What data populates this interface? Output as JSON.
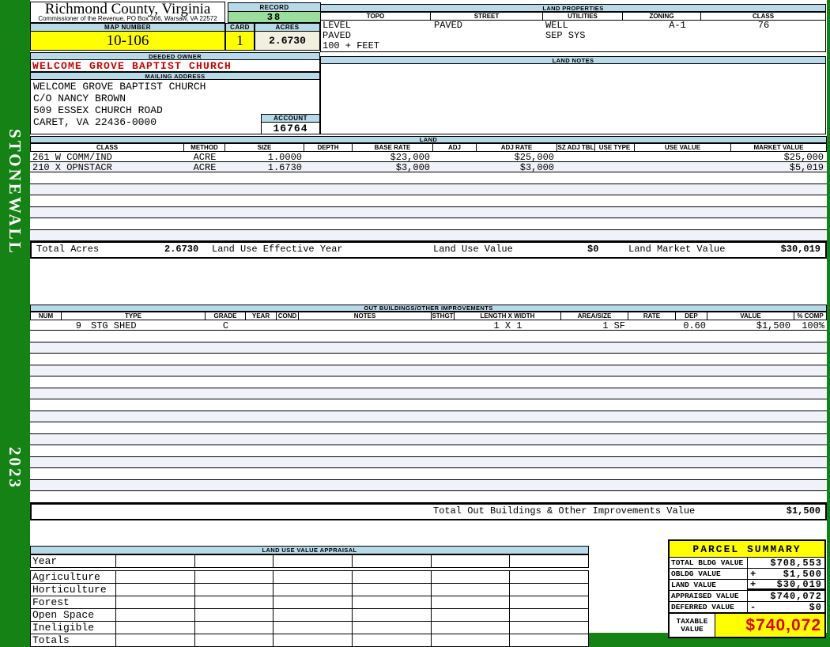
{
  "sidebar": {
    "district": "STONEWALL",
    "year": "2023"
  },
  "header": {
    "county": "Richmond County, Virginia",
    "office": "Commissioner of the Revenue, PO Box 366, Warsaw, VA 22572",
    "record_label": "RECORD",
    "record": "38",
    "map_number_label": "MAP NUMBER",
    "map_number": "10-106",
    "card_label": "CARD",
    "card": "1",
    "acres_label": "ACRES",
    "acres": "2.6730"
  },
  "land_properties": {
    "title": "LAND PROPERTIES",
    "columns": [
      "TOPO",
      "STREET",
      "UTILITIES",
      "ZONING",
      "CLASS"
    ],
    "topo": [
      "LEVEL",
      "PAVED",
      "100 + FEET"
    ],
    "street": "PAVED",
    "utilities": [
      "WELL",
      "SEP SYS"
    ],
    "zoning": "A-1",
    "class": "76"
  },
  "owner": {
    "deeded_owner_label": "DEEDED OWNER",
    "deeded_owner": "WELCOME GROVE BAPTIST CHURCH",
    "mailing_address_label": "MAILING ADDRESS",
    "mailing_address": [
      "WELCOME GROVE BAPTIST CHURCH",
      "C/O NANCY BROWN",
      "509 ESSEX CHURCH ROAD",
      "CARET, VA 22436-0000"
    ],
    "account_label": "ACCOUNT",
    "account": "16764"
  },
  "land_notes": {
    "title": "LAND NOTES"
  },
  "land": {
    "title": "LAND",
    "columns": [
      "CLASS",
      "METHOD",
      "SIZE",
      "DEPTH",
      "BASE RATE",
      "ADJ",
      "ADJ RATE",
      "SZ ADJ TBL",
      "USE TYPE",
      "USE VALUE",
      "MARKET VALUE"
    ],
    "rows": [
      {
        "class": "261 W COMM/IND",
        "method": "ACRE",
        "size": "1.0000",
        "depth": "",
        "base_rate": "$23,000",
        "adj": "",
        "adj_rate": "$25,000",
        "sz_adj_tbl": "",
        "use_type": "",
        "use_value": "",
        "market_value": "$25,000"
      },
      {
        "class": "210 X OPNSTACR",
        "method": "ACRE",
        "size": "1.6730",
        "depth": "",
        "base_rate": "$3,000",
        "adj": "",
        "adj_rate": "$3,000",
        "sz_adj_tbl": "",
        "use_type": "",
        "use_value": "",
        "market_value": "$5,019"
      }
    ],
    "totals": {
      "total_acres_label": "Total Acres",
      "total_acres": "2.6730",
      "effective_year_label": "Land Use Effective Year",
      "use_value_label": "Land Use Value",
      "use_value": "$0",
      "market_value_label": "Land Market Value",
      "market_value": "$30,019"
    }
  },
  "out_buildings": {
    "title": "OUT BUILDINGS/OTHER IMPROVEMENTS",
    "columns": [
      "NUM",
      "TYPE",
      "GRADE",
      "YEAR",
      "COND",
      "NOTES",
      "STHGT",
      "LENGTH X WIDTH",
      "AREA/SIZE",
      "RATE",
      "DEP",
      "VALUE",
      "% COMP"
    ],
    "rows": [
      {
        "num": "9",
        "type": "STG SHED",
        "grade": "C",
        "year": "",
        "cond": "",
        "notes": "",
        "sthgt": "",
        "length_width": "1 X 1",
        "area_size": "1 SF",
        "rate": "",
        "dep": "0.60",
        "value": "$1,500",
        "pct_comp": "100%"
      }
    ],
    "total_label": "Total Out Buildings & Other Improvements Value",
    "total_value": "$1,500"
  },
  "land_use_appraisal": {
    "title": "LAND USE VALUE APPRAISAL",
    "row_labels": [
      "Year",
      "Agriculture",
      "Horticulture",
      "Forest",
      "Open Space",
      "Ineligible",
      "Totals"
    ]
  },
  "parcel_summary": {
    "title": "PARCEL SUMMARY",
    "rows": [
      {
        "label": "TOTAL BLDG VALUE",
        "sign": "",
        "value": "$708,553"
      },
      {
        "label": "OBLDG VALUE",
        "sign": "+",
        "value": "$1,500"
      },
      {
        "label": "LAND VALUE",
        "sign": "+",
        "value": "$30,019"
      },
      {
        "label": "APPRAISED VALUE",
        "sign": "",
        "value": "$740,072"
      },
      {
        "label": "DEFERRED VALUE",
        "sign": "-",
        "value": "$0"
      }
    ],
    "taxable_label": "TAXABLE VALUE",
    "taxable_value": "$740,072"
  },
  "colors": {
    "sidebar_green": "#148214",
    "header_blue": "#b7d9e8",
    "record_green": "#9bde9b",
    "highlight_yellow": "#ffff00",
    "acres_cream": "#f0efe0",
    "owner_red": "#cc0000",
    "taxable_red": "#e00000"
  }
}
